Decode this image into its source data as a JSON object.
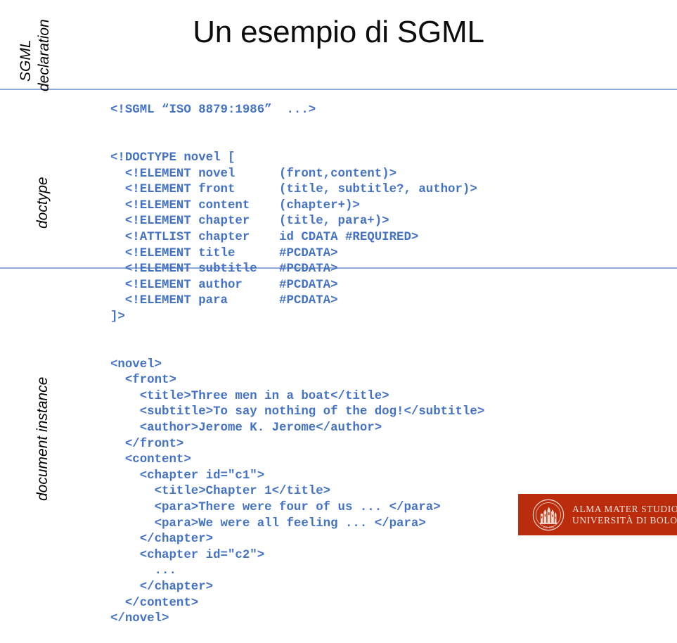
{
  "slide": {
    "title": "Un esempio di SGML",
    "background_color": "#ffffff",
    "code_color": "#4472c4",
    "rule_color": "#8eaadb",
    "logo_color": "#ba2c0c"
  },
  "side_labels": {
    "sgml_declaration_line1": "SGML",
    "sgml_declaration_line2": "declaration",
    "doctype": "doctype",
    "document_instance": "document instance"
  },
  "code": {
    "sgml_declaration": [
      "<!SGML “ISO 8879:1986”  ...>"
    ],
    "doctype": [
      "<!DOCTYPE novel [",
      "  <!ELEMENT novel      (front,content)>",
      "  <!ELEMENT front      (title, subtitle?, author)>",
      "  <!ELEMENT content    (chapter+)>",
      "  <!ELEMENT chapter    (title, para+)>",
      "  <!ATTLIST chapter    id CDATA #REQUIRED>",
      "  <!ELEMENT title      #PCDATA>",
      "  <!ELEMENT subtitle   #PCDATA>",
      "  <!ELEMENT author     #PCDATA>",
      "  <!ELEMENT para       #PCDATA>",
      "]>"
    ],
    "document_instance": [
      "<novel>",
      "  <front>",
      "    <title>Three men in a boat</title>",
      "    <subtitle>To say nothing of the dog!</subtitle>",
      "    <author>Jerome K. Jerome</author>",
      "  </front>",
      "  <content>",
      "    <chapter id=\"c1\">",
      "      <title>Chapter 1</title>",
      "      <para>There were four of us ... </para>",
      "      <para>We were all feeling ... </para>",
      "    </chapter>",
      "    <chapter id=\"c2\">",
      "      ...",
      "    </chapter>",
      "  </content>",
      "</novel>"
    ]
  },
  "logo": {
    "line1": "ALMA MATER STUDIORUM",
    "line2": "UNIVERSITÀ DI BOLOGNA",
    "seal_alt": "university-seal"
  }
}
